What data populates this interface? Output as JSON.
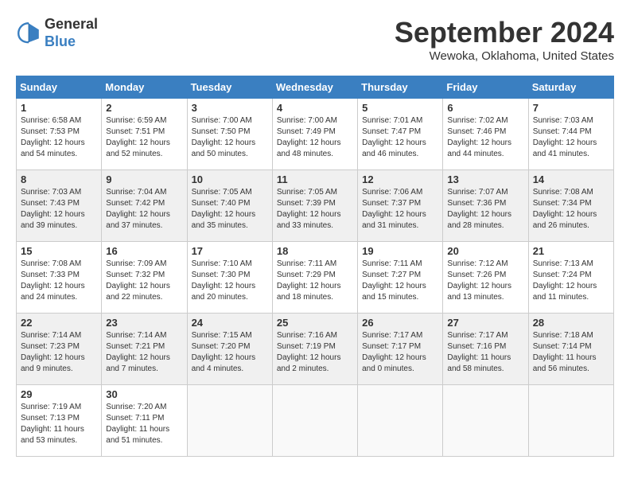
{
  "header": {
    "logo_general": "General",
    "logo_blue": "Blue",
    "month_title": "September 2024",
    "location": "Wewoka, Oklahoma, United States"
  },
  "weekdays": [
    "Sunday",
    "Monday",
    "Tuesday",
    "Wednesday",
    "Thursday",
    "Friday",
    "Saturday"
  ],
  "weeks": [
    [
      {
        "day": "1",
        "info": "Sunrise: 6:58 AM\nSunset: 7:53 PM\nDaylight: 12 hours\nand 54 minutes."
      },
      {
        "day": "2",
        "info": "Sunrise: 6:59 AM\nSunset: 7:51 PM\nDaylight: 12 hours\nand 52 minutes."
      },
      {
        "day": "3",
        "info": "Sunrise: 7:00 AM\nSunset: 7:50 PM\nDaylight: 12 hours\nand 50 minutes."
      },
      {
        "day": "4",
        "info": "Sunrise: 7:00 AM\nSunset: 7:49 PM\nDaylight: 12 hours\nand 48 minutes."
      },
      {
        "day": "5",
        "info": "Sunrise: 7:01 AM\nSunset: 7:47 PM\nDaylight: 12 hours\nand 46 minutes."
      },
      {
        "day": "6",
        "info": "Sunrise: 7:02 AM\nSunset: 7:46 PM\nDaylight: 12 hours\nand 44 minutes."
      },
      {
        "day": "7",
        "info": "Sunrise: 7:03 AM\nSunset: 7:44 PM\nDaylight: 12 hours\nand 41 minutes."
      }
    ],
    [
      {
        "day": "8",
        "info": "Sunrise: 7:03 AM\nSunset: 7:43 PM\nDaylight: 12 hours\nand 39 minutes."
      },
      {
        "day": "9",
        "info": "Sunrise: 7:04 AM\nSunset: 7:42 PM\nDaylight: 12 hours\nand 37 minutes."
      },
      {
        "day": "10",
        "info": "Sunrise: 7:05 AM\nSunset: 7:40 PM\nDaylight: 12 hours\nand 35 minutes."
      },
      {
        "day": "11",
        "info": "Sunrise: 7:05 AM\nSunset: 7:39 PM\nDaylight: 12 hours\nand 33 minutes."
      },
      {
        "day": "12",
        "info": "Sunrise: 7:06 AM\nSunset: 7:37 PM\nDaylight: 12 hours\nand 31 minutes."
      },
      {
        "day": "13",
        "info": "Sunrise: 7:07 AM\nSunset: 7:36 PM\nDaylight: 12 hours\nand 28 minutes."
      },
      {
        "day": "14",
        "info": "Sunrise: 7:08 AM\nSunset: 7:34 PM\nDaylight: 12 hours\nand 26 minutes."
      }
    ],
    [
      {
        "day": "15",
        "info": "Sunrise: 7:08 AM\nSunset: 7:33 PM\nDaylight: 12 hours\nand 24 minutes."
      },
      {
        "day": "16",
        "info": "Sunrise: 7:09 AM\nSunset: 7:32 PM\nDaylight: 12 hours\nand 22 minutes."
      },
      {
        "day": "17",
        "info": "Sunrise: 7:10 AM\nSunset: 7:30 PM\nDaylight: 12 hours\nand 20 minutes."
      },
      {
        "day": "18",
        "info": "Sunrise: 7:11 AM\nSunset: 7:29 PM\nDaylight: 12 hours\nand 18 minutes."
      },
      {
        "day": "19",
        "info": "Sunrise: 7:11 AM\nSunset: 7:27 PM\nDaylight: 12 hours\nand 15 minutes."
      },
      {
        "day": "20",
        "info": "Sunrise: 7:12 AM\nSunset: 7:26 PM\nDaylight: 12 hours\nand 13 minutes."
      },
      {
        "day": "21",
        "info": "Sunrise: 7:13 AM\nSunset: 7:24 PM\nDaylight: 12 hours\nand 11 minutes."
      }
    ],
    [
      {
        "day": "22",
        "info": "Sunrise: 7:14 AM\nSunset: 7:23 PM\nDaylight: 12 hours\nand 9 minutes."
      },
      {
        "day": "23",
        "info": "Sunrise: 7:14 AM\nSunset: 7:21 PM\nDaylight: 12 hours\nand 7 minutes."
      },
      {
        "day": "24",
        "info": "Sunrise: 7:15 AM\nSunset: 7:20 PM\nDaylight: 12 hours\nand 4 minutes."
      },
      {
        "day": "25",
        "info": "Sunrise: 7:16 AM\nSunset: 7:19 PM\nDaylight: 12 hours\nand 2 minutes."
      },
      {
        "day": "26",
        "info": "Sunrise: 7:17 AM\nSunset: 7:17 PM\nDaylight: 12 hours\nand 0 minutes."
      },
      {
        "day": "27",
        "info": "Sunrise: 7:17 AM\nSunset: 7:16 PM\nDaylight: 11 hours\nand 58 minutes."
      },
      {
        "day": "28",
        "info": "Sunrise: 7:18 AM\nSunset: 7:14 PM\nDaylight: 11 hours\nand 56 minutes."
      }
    ],
    [
      {
        "day": "29",
        "info": "Sunrise: 7:19 AM\nSunset: 7:13 PM\nDaylight: 11 hours\nand 53 minutes."
      },
      {
        "day": "30",
        "info": "Sunrise: 7:20 AM\nSunset: 7:11 PM\nDaylight: 11 hours\nand 51 minutes."
      },
      {
        "day": "",
        "info": ""
      },
      {
        "day": "",
        "info": ""
      },
      {
        "day": "",
        "info": ""
      },
      {
        "day": "",
        "info": ""
      },
      {
        "day": "",
        "info": ""
      }
    ]
  ]
}
